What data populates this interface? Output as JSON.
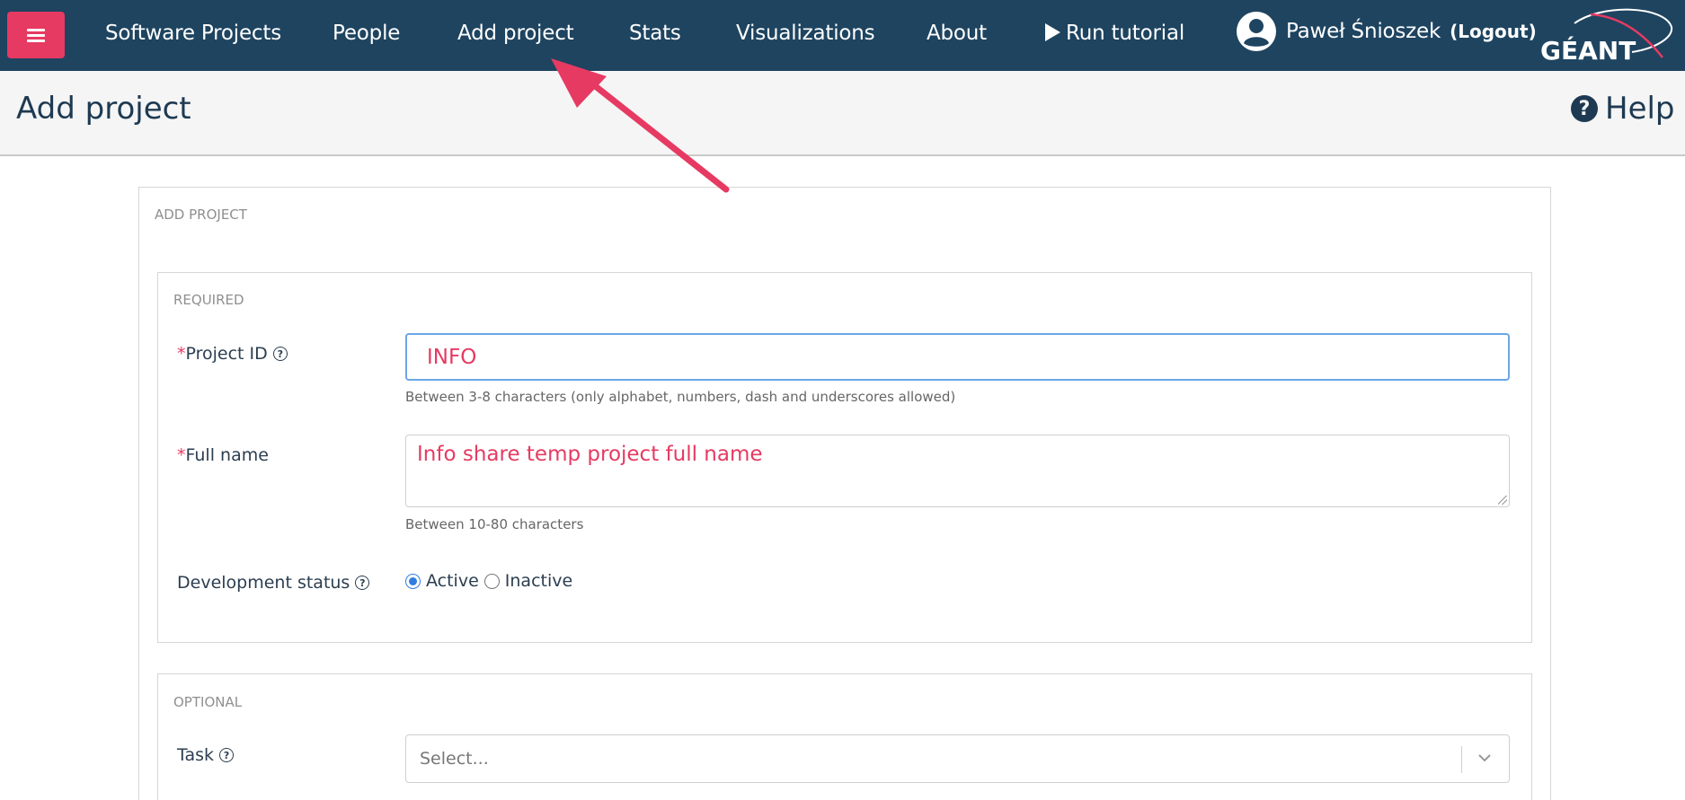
{
  "nav": {
    "items": [
      "Software Projects",
      "People",
      "Add project",
      "Stats",
      "Visualizations",
      "About"
    ],
    "tutorial_label": "Run tutorial",
    "user_name": "Paweł Śnioszek",
    "logout_label": "(Logout)",
    "brand": "GÉANT"
  },
  "page": {
    "title": "Add project",
    "help_label": "Help"
  },
  "form": {
    "section_title": "ADD PROJECT",
    "required": {
      "label": "REQUIRED",
      "project_id": {
        "label": "Project ID",
        "value": "INFO",
        "hint": "Between 3-8 characters (only alphabet, numbers, dash and underscores allowed)"
      },
      "full_name": {
        "label": "Full name",
        "value": "Info share temp project full name",
        "hint": "Between 10-80 characters"
      },
      "dev_status": {
        "label": "Development status",
        "options": [
          "Active",
          "Inactive"
        ],
        "selected": "Active"
      }
    },
    "optional": {
      "label": "OPTIONAL",
      "task": {
        "label": "Task",
        "placeholder": "Select..."
      }
    }
  },
  "colors": {
    "navbar": "#1e4460",
    "accent": "#e63a62",
    "focus": "#6aa6e6"
  }
}
